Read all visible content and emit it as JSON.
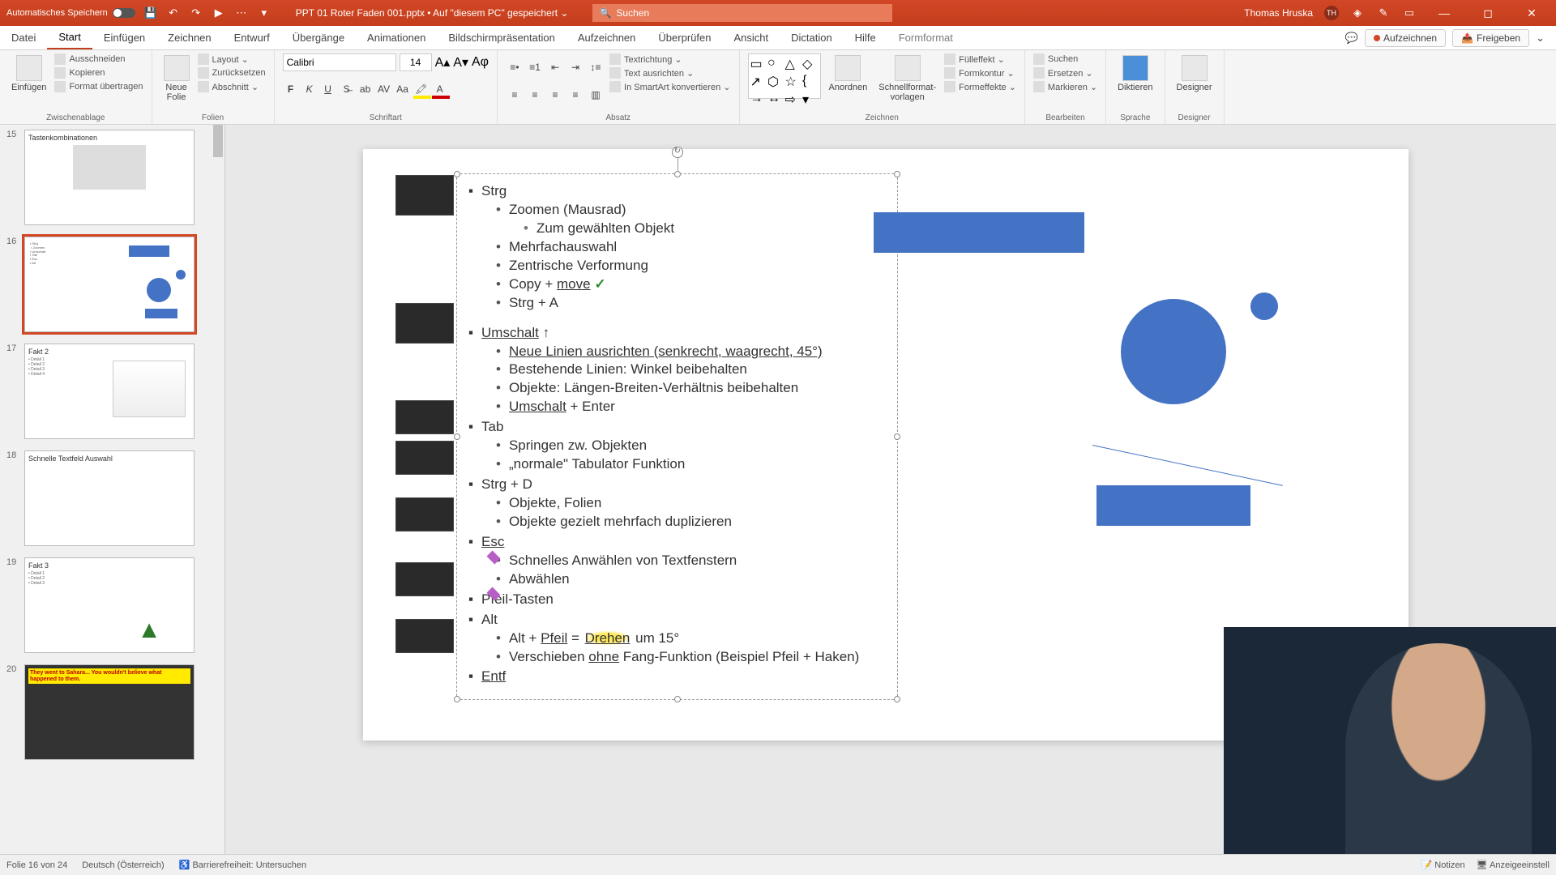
{
  "titlebar": {
    "autosave": "Automatisches Speichern",
    "filename": "PPT 01 Roter Faden 001.pptx • Auf \"diesem PC\" gespeichert ⌄",
    "search_placeholder": "Suchen",
    "username": "Thomas Hruska",
    "initials": "TH"
  },
  "tabs": {
    "datei": "Datei",
    "start": "Start",
    "einfuegen": "Einfügen",
    "zeichnen": "Zeichnen",
    "entwurf": "Entwurf",
    "uebergaenge": "Übergänge",
    "animationen": "Animationen",
    "bildschirm": "Bildschirmpräsentation",
    "aufzeichnen": "Aufzeichnen",
    "ueberpruefen": "Überprüfen",
    "ansicht": "Ansicht",
    "dictation": "Dictation",
    "hilfe": "Hilfe",
    "formformat": "Formformat",
    "aufzeichnen_btn": "Aufzeichnen",
    "freigeben": "Freigeben"
  },
  "ribbon": {
    "zwischenablage": "Zwischenablage",
    "einfuegen": "Einfügen",
    "ausschneiden": "Ausschneiden",
    "kopieren": "Kopieren",
    "format_uebertragen": "Format übertragen",
    "folien": "Folien",
    "neue_folie": "Neue\nFolie",
    "layout": "Layout ⌄",
    "zuruecksetzen": "Zurücksetzen",
    "abschnitt": "Abschnitt ⌄",
    "schriftart": "Schriftart",
    "font_name": "Calibri",
    "font_size": "14",
    "absatz": "Absatz",
    "textrichtung": "Textrichtung ⌄",
    "text_ausrichten": "Text ausrichten ⌄",
    "smartart": "In SmartArt konvertieren ⌄",
    "zeichnen": "Zeichnen",
    "anordnen": "Anordnen",
    "schnellformat": "Schnellformat-\nvorlagen",
    "fuelleffekt": "Fülleffekt ⌄",
    "formkontur": "Formkontur ⌄",
    "formeffekte": "Formeffekte ⌄",
    "bearbeiten": "Bearbeiten",
    "suchen": "Suchen",
    "ersetzen": "Ersetzen ⌄",
    "markieren": "Markieren ⌄",
    "sprache": "Sprache",
    "diktieren": "Diktieren",
    "designer": "Designer"
  },
  "thumbs": {
    "n15": "15",
    "t15": "Tastenkombinationen",
    "n16": "16",
    "n17": "17",
    "t17": "Fakt 2",
    "n18": "18",
    "t18": "Schnelle Textfeld Auswahl",
    "n19": "19",
    "t19": "Fakt 3",
    "n20": "20",
    "t20": "They went to Sahara... You wouldn't believe what happened to them."
  },
  "content": {
    "strg": "Strg",
    "zoomen": "Zoomen (Mausrad)",
    "zum_obj": "Zum gewählten Objekt",
    "mehrfach": "Mehrfachauswahl",
    "zentrisch": "Zentrische Verformung",
    "copymove_a": "Copy + ",
    "copymove_b": "move",
    "check": " ✓",
    "strga": "Strg + A",
    "umschalt": "Umschalt",
    "up": " ↑",
    "neue_linien": "Neue Linien ausrichten (senkrecht, waagrecht, 45°)",
    "bestehende": "Bestehende Linien: Winkel beibehalten",
    "objekte_lb": "Objekte: Längen-Breiten-Verhältnis beibehalten",
    "umschalt_enter_a": "Umschalt",
    "umschalt_enter_b": " + Enter",
    "tab": "Tab",
    "springen": "Springen zw. Objekten",
    "normale_tab": "„normale\" Tabulator Funktion",
    "strgd": "Strg + D",
    "obj_folien": "Objekte, Folien",
    "obj_dup": "Objekte gezielt mehrfach duplizieren",
    "esc": "Esc",
    "schnelles": "Schnelles Anwählen von Textfenstern",
    "abwaehlen": "Abwählen",
    "pfeil_tasten": "Pfeil-Tasten",
    "alt": "Alt",
    "alt_pfeil_a": "Alt + ",
    "alt_pfeil_b": "Pfeil",
    "alt_pfeil_c": " = ",
    "alt_pfeil_d": "Drehen",
    "alt_pfeil_e": " um 15°",
    "verschieben_a": "Verschieben ",
    "verschieben_b": "ohne",
    "verschieben_c": " Fang-Funktion (Beispiel Pfeil + Haken)",
    "entf": "Entf"
  },
  "status": {
    "folie": "Folie 16 von 24",
    "lang": "Deutsch (Österreich)",
    "barrierefreiheit": "Barrierefreiheit: Untersuchen",
    "notizen": "Notizen",
    "anzeige": "Anzeigeeinstell"
  }
}
